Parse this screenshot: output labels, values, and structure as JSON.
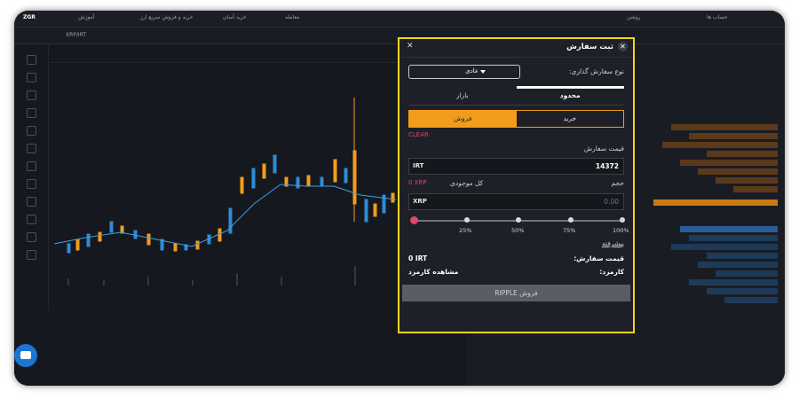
{
  "header": {
    "logo": "ZGR",
    "links": [
      "آموزش",
      "خرید و فروش سریع ارز",
      "خرید آسان",
      "معامله"
    ],
    "right_user": "حساب ها",
    "theme_label": "روشن",
    "pair_label": "XRP/IRT"
  },
  "order_modal": {
    "title": "ثبت سفارش",
    "order_type_label": "نوع سفارش گذاری:",
    "order_type_value": "عادی",
    "tabs": [
      "بازار",
      "محدود"
    ],
    "active_tab": "محدود",
    "side_buy_label": "خرید",
    "side_sell_label": "فروش",
    "active_side": "فروش",
    "clear_label": "CLEAR",
    "price_label": "قیمت سفارش",
    "price_unit": "IRT",
    "price_value": "14372",
    "volume_label": "حجم",
    "balance_label": "کل موجودی",
    "balance_value": "0 XRP",
    "volume_unit": "XRP",
    "volume_placeholder": "0.00",
    "slider_marks": [
      "25%",
      "50%",
      "75%",
      "100%"
    ],
    "slider_value": 0,
    "advanced_label": "پیشرفته",
    "total_label": "قیمت سفارش:",
    "total_value": "0 IRT",
    "fee_label": "کارمزد:",
    "fee_value": "مشاهده کارمزد",
    "submit_label": "فروش RIPPLE",
    "colors": {
      "accent": "#f39c1b",
      "highlight_border": "#f2d41e",
      "danger": "#e0476a",
      "panel_bg": "#1e2027"
    }
  }
}
